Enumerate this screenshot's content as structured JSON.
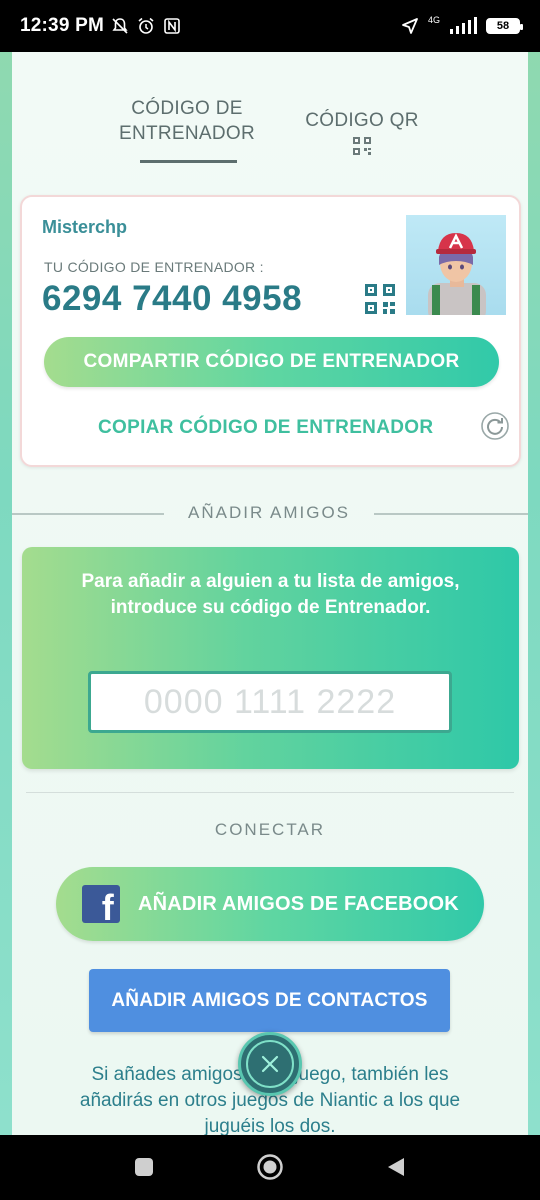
{
  "status_bar": {
    "time": "12:39 PM",
    "network": "4G",
    "battery": "58",
    "icons": [
      "mute-icon",
      "alarm-icon",
      "nfc-icon",
      "location-icon",
      "signal-icon",
      "battery-icon"
    ]
  },
  "tabs": {
    "trainer_code_line1": "CÓDIGO DE",
    "trainer_code_line2": "ENTRENADOR",
    "qr_code": "CÓDIGO QR"
  },
  "trainer_card": {
    "name": "Misterchp",
    "code_label": "TU CÓDIGO DE ENTRENADOR :",
    "code": "6294 7440 4958",
    "share_button": "COMPARTIR CÓDIGO DE ENTRENADOR",
    "copy_button": "COPIAR CÓDIGO DE ENTRENADOR"
  },
  "add_friends": {
    "section_title": "AÑADIR AMIGOS",
    "description": "Para añadir a alguien a tu lista de amigos, introduce su código de Entrenador.",
    "input_placeholder": "0000 1111 2222"
  },
  "connect": {
    "section_title": "CONECTAR",
    "facebook_button": "AÑADIR AMIGOS DE FACEBOOK",
    "contacts_button": "AÑADIR AMIGOS DE CONTACTOS",
    "footer": "Si añades amigos en el juego, también les añadirás en otros juegos de Niantic a los que juguéis los dos."
  },
  "colors": {
    "accent_green": "#5fd6a2",
    "teal_text": "#2a7b87",
    "contacts_blue": "#4f8fe0",
    "facebook_blue": "#3b5998"
  }
}
